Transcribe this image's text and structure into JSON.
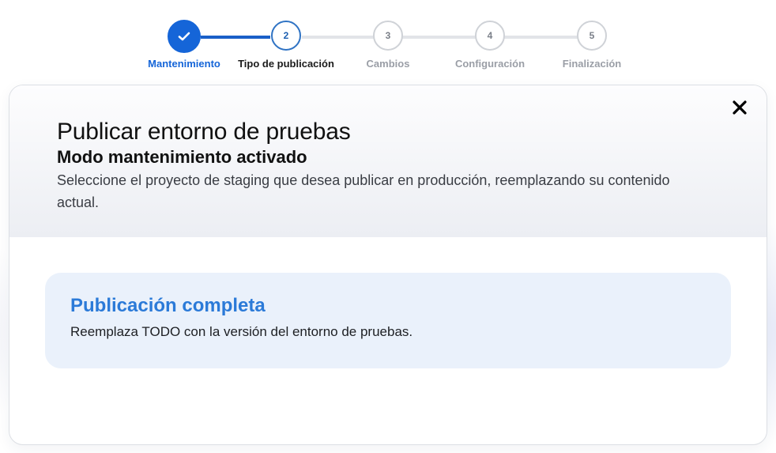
{
  "stepper": {
    "steps": [
      {
        "number": "1",
        "label": "Mantenimiento",
        "state": "complete"
      },
      {
        "number": "2",
        "label": "Tipo de publicación",
        "state": "current"
      },
      {
        "number": "3",
        "label": "Cambios",
        "state": "pending"
      },
      {
        "number": "4",
        "label": "Configuración",
        "state": "pending"
      },
      {
        "number": "5",
        "label": "Finalización",
        "state": "pending"
      }
    ]
  },
  "dialog": {
    "close_icon": "close-icon",
    "title": "Publicar entorno de pruebas",
    "subtitle": "Modo mantenimiento activado",
    "description": "Seleccione el proyecto de staging que desea publicar en producción, reemplazando su contenido actual.",
    "option": {
      "title": "Publicación completa",
      "description": "Reemplaza TODO con la versión del entorno de pruebas."
    }
  },
  "colors": {
    "accent": "#1565d8",
    "option_title": "#2b7ad8",
    "option_bg": "#eaf1fb"
  }
}
